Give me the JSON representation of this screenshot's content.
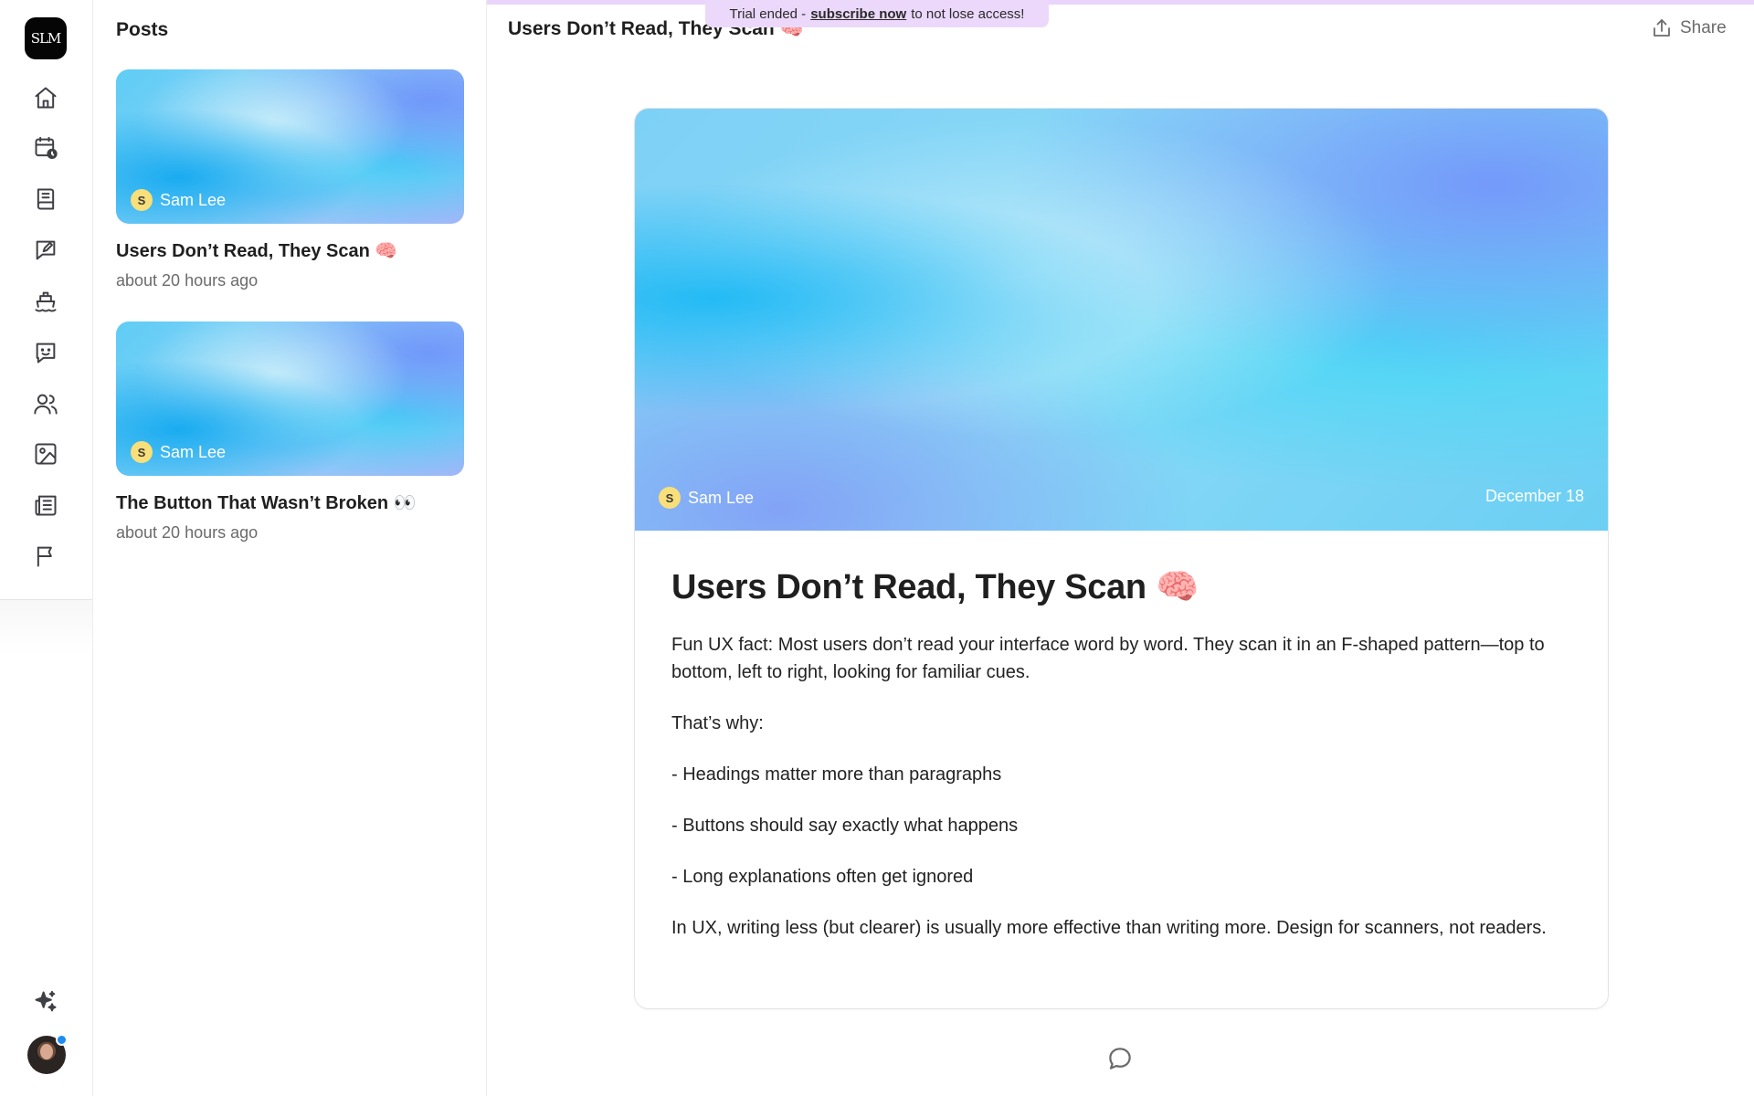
{
  "banner": {
    "prefix": "Trial ended -",
    "link": "subscribe now",
    "suffix": "to not lose access!"
  },
  "rail": {
    "logo_text": "SLM",
    "icons": [
      "home-icon",
      "calendar-clock-icon",
      "book-icon",
      "edit-chat-icon",
      "ship-icon",
      "smile-chat-icon",
      "users-icon",
      "image-icon",
      "newspaper-icon",
      "flag-icon",
      "sparkles-icon"
    ]
  },
  "posts": {
    "title": "Posts",
    "items": [
      {
        "author_initial": "S",
        "author": "Sam Lee",
        "title": "Users Don’t Read, They Scan 🧠",
        "time": "about 20 hours ago"
      },
      {
        "author_initial": "S",
        "author": "Sam Lee",
        "title": "The Button That Wasn’t Broken 👀",
        "time": "about 20 hours ago"
      }
    ]
  },
  "main": {
    "header_title": "Users Don’t Read, They Scan 🧠",
    "share_label": "Share",
    "article": {
      "author_initial": "S",
      "author": "Sam Lee",
      "date": "December 18",
      "heading": "Users Don’t Read, They Scan 🧠",
      "paragraphs": [
        "Fun UX fact: Most users don’t read your interface word by word. They scan it in an F-shaped pattern—top to bottom, left to right, looking for familiar cues.",
        "That’s why:",
        "- Headings matter more than paragraphs",
        "- Buttons should say exactly what happens",
        "- Long explanations often get ignored",
        "In UX, writing less (but clearer) is usually more effective than writing more. Design for scanners, not readers."
      ]
    }
  }
}
